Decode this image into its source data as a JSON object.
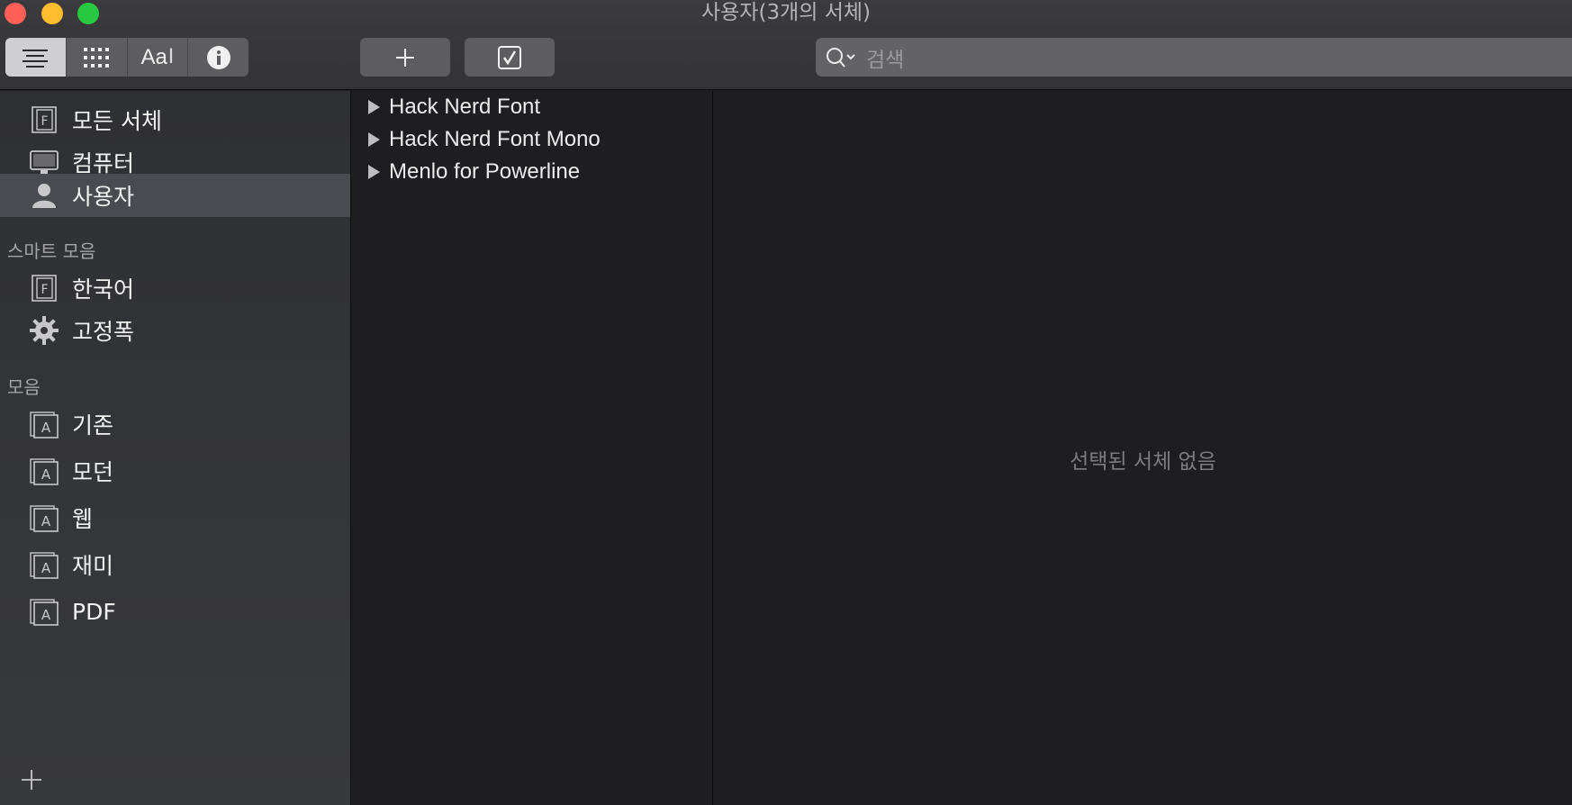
{
  "window": {
    "title": "사용자(3개의 서체)"
  },
  "toolbar": {
    "view_modes": [
      {
        "name": "list-view",
        "icon": "list-lines-icon",
        "active": true
      },
      {
        "name": "grid-view",
        "icon": "grid-dots-icon",
        "active": false
      },
      {
        "name": "sample-view",
        "icon": "text-sample-icon",
        "label": "Aa",
        "active": false
      },
      {
        "name": "info-view",
        "icon": "info-icon",
        "active": false
      }
    ],
    "add_icon": "plus-icon",
    "validate_icon": "checkbox-icon",
    "search": {
      "placeholder": "검색",
      "icon": "search-icon"
    }
  },
  "sidebar": {
    "library_items": [
      {
        "label": "모든 서체",
        "icon": "font-book-icon",
        "selected": false
      },
      {
        "label": "컴퓨터",
        "icon": "computer-icon",
        "selected": false
      },
      {
        "label": "사용자",
        "icon": "user-icon",
        "selected": true
      }
    ],
    "smart_header": "스마트 모음",
    "smart_items": [
      {
        "label": "한국어",
        "icon": "font-book-icon"
      },
      {
        "label": "고정폭",
        "icon": "gear-icon"
      }
    ],
    "collections_header": "모음",
    "collection_items": [
      {
        "label": "기존",
        "icon": "collection-icon"
      },
      {
        "label": "모던",
        "icon": "collection-icon"
      },
      {
        "label": "웹",
        "icon": "collection-icon"
      },
      {
        "label": "재미",
        "icon": "collection-icon"
      },
      {
        "label": "PDF",
        "icon": "collection-icon"
      }
    ],
    "add_icon": "plus-icon"
  },
  "font_list": [
    {
      "name": "Hack Nerd Font"
    },
    {
      "name": "Hack Nerd Font Mono"
    },
    {
      "name": "Menlo for Powerline"
    }
  ],
  "preview": {
    "empty_message": "선택된 서체 없음"
  },
  "colors": {
    "close": "#fe5f57",
    "minimize": "#febc2e",
    "maximize": "#28c840",
    "selection": "#4a4b50"
  }
}
